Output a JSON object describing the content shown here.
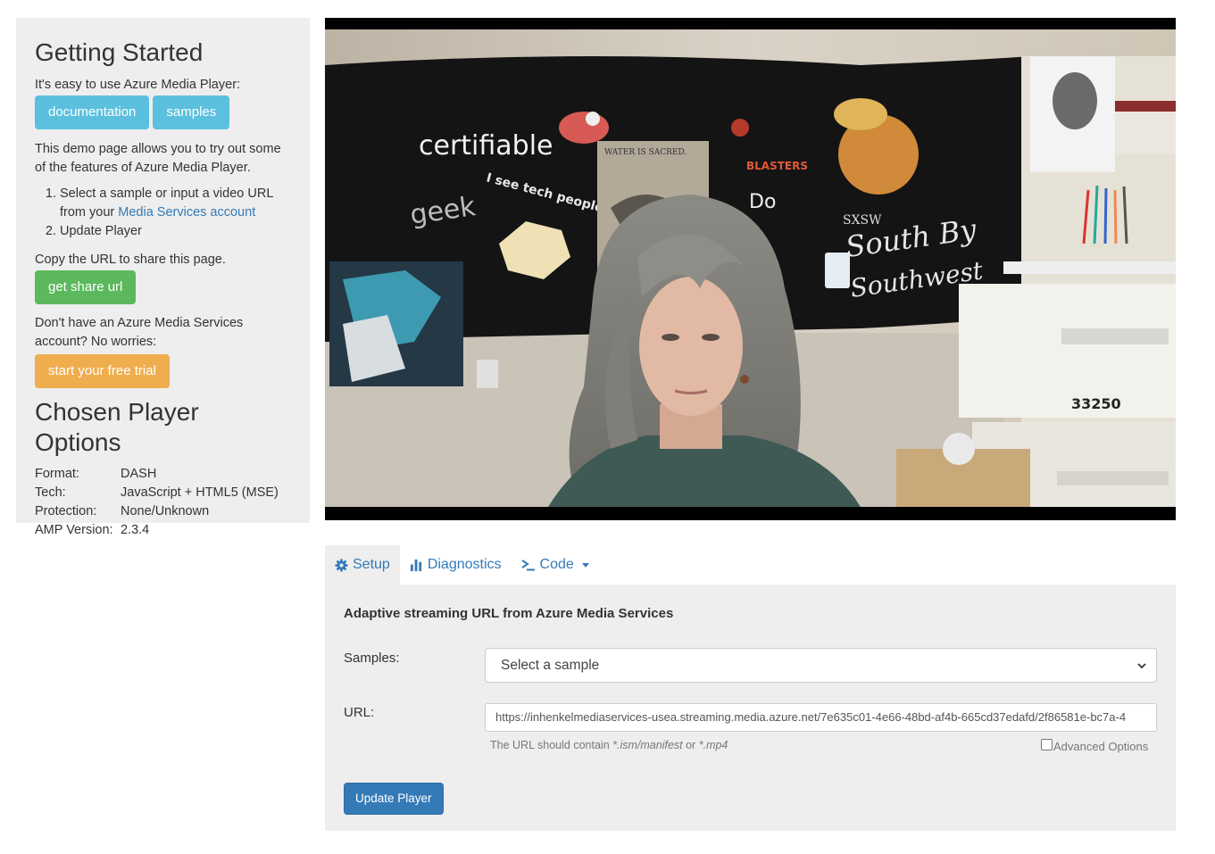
{
  "sidebar": {
    "getting_started_title": "Getting Started",
    "intro": "It's easy to use Azure Media Player:",
    "btn_documentation": "documentation",
    "btn_samples": "samples",
    "demo_text": "This demo page allows you to try out some of the features of Azure Media Player.",
    "step1_prefix": "Select a sample or input a video URL from your",
    "step1_link": "Media Services account",
    "step2": "Update Player",
    "copy_url_text": "Copy the URL to share this page.",
    "btn_share": "get share url",
    "no_account_text": "Don't have an Azure Media Services account? No worries:",
    "btn_trial": "start your free trial",
    "options_title": "Chosen Player Options",
    "options": [
      {
        "key": "Format:",
        "value": "DASH"
      },
      {
        "key": "Tech:",
        "value": "JavaScript + HTML5 (MSE)"
      },
      {
        "key": "Protection:",
        "value": "None/Unknown"
      },
      {
        "key": "AMP Version:",
        "value": "2.3.4"
      }
    ]
  },
  "video": {
    "poster_labels": {
      "certifiable": "certifiable",
      "geek": "geek",
      "tech_people": "I see tech people.",
      "water": "WATER IS SACRED.",
      "blasters": "BLASTERS",
      "sxsw": "SXSW",
      "south_by": "South By",
      "southwest": "Southwest",
      "box_number": "33250"
    }
  },
  "tabs": [
    {
      "label": "Setup",
      "icon": "gear-icon"
    },
    {
      "label": "Diagnostics",
      "icon": "bar-chart-icon"
    },
    {
      "label": "Code",
      "icon": "terminal-icon"
    }
  ],
  "panel": {
    "title": "Adaptive streaming URL from Azure Media Services",
    "samples_label": "Samples:",
    "select_value": "Select a sample",
    "url_label": "URL:",
    "url_value": "https://inhenkelmediaservices-usea.streaming.media.azure.net/7e635c01-4e66-48bd-af4b-665cd37edafd/2f86581e-bc7a-4",
    "help_prefix": "The URL should contain ",
    "help_ism": "*.ism/manifest",
    "help_or": " or ",
    "help_mp4": "*.mp4",
    "advanced_options": "Advanced Options",
    "update_button": "Update Player"
  },
  "colors": {
    "info": "#5bc0de",
    "success": "#5cb85c",
    "warning": "#f0ad4e",
    "primary": "#337ab7",
    "panel_bg": "#eeeeee"
  }
}
